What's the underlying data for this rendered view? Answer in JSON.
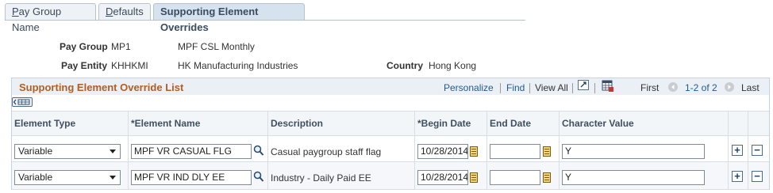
{
  "tabs": [
    {
      "label": "Pay Group Name",
      "underline": "P",
      "rest": "ay Group Name"
    },
    {
      "label": "Defaults",
      "underline": "D",
      "rest": "efaults"
    },
    {
      "label": "Supporting Element Overrides"
    }
  ],
  "header": {
    "pay_group_label": "Pay Group",
    "pay_group_value": "MP1",
    "pay_group_desc": "MPF CSL Monthly",
    "pay_entity_label": "Pay Entity",
    "pay_entity_value": "KHHKMI",
    "pay_entity_desc": "HK Manufacturing Industries",
    "country_label": "Country",
    "country_value": "Hong Kong"
  },
  "grid": {
    "title": "Supporting Element Override List",
    "personalize": "Personalize",
    "find": "Find",
    "view_all": "View All",
    "first": "First",
    "range": "1-2 of 2",
    "last": "Last",
    "columns": {
      "element_type": "Element Type",
      "element_name": "*Element Name",
      "description": "Description",
      "begin_date": "*Begin Date",
      "end_date": "End Date",
      "character_value": "Character Value"
    },
    "rows": [
      {
        "element_type": "Variable",
        "element_name": "MPF VR CASUAL FLG",
        "description": "Casual paygroup staff flag",
        "begin_date": "10/28/2014",
        "end_date": "",
        "character_value": "Y"
      },
      {
        "element_type": "Variable",
        "element_name": "MPF VR IND DLY EE",
        "description": "Industry - Daily Paid EE",
        "begin_date": "10/28/2014",
        "end_date": "",
        "character_value": "Y"
      }
    ],
    "add_symbol": "+",
    "remove_symbol": "−"
  }
}
